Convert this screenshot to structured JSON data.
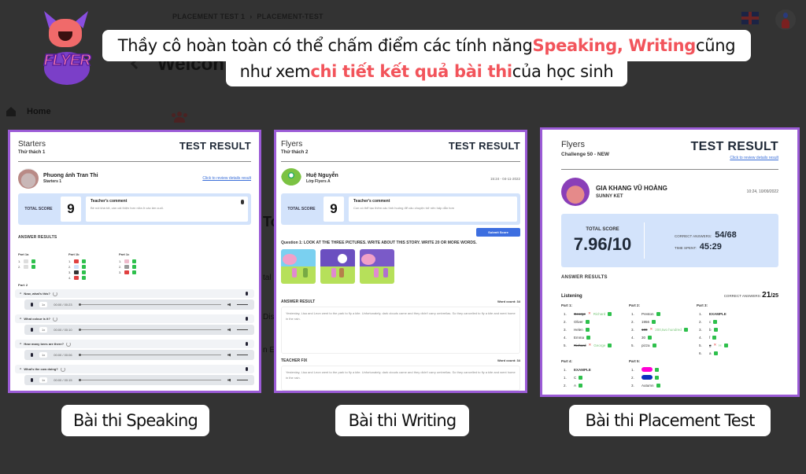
{
  "background_app": {
    "breadcrumb": [
      "PLACEMENT TEST 1",
      "›",
      "PLACEMENT-TEST"
    ],
    "welcome_partial": "Welcon",
    "sidebar_home": "Home",
    "side_fragments": [
      "Tc",
      "tal",
      "Dis",
      "n E"
    ]
  },
  "logo": {
    "text": "FLYER"
  },
  "callout": {
    "line1_a": "Thầy cô hoàn toàn có thể chấm điểm các tính năng ",
    "line1_hl": "Speaking, Writing",
    "line1_b": " cũng",
    "line2_a": "như xem ",
    "line2_hl": "chi tiết kết quả bài thi",
    "line2_b": " của học sinh",
    "highlight_color": "#f2545b"
  },
  "speaking_card": {
    "level": "Starters",
    "challenge": "Thử thách 1",
    "title": "TEST RESULT",
    "student_name": "Phuong ánh Tran Thi",
    "student_class": "Starters 1",
    "review_link": "Click to review details result",
    "score_label": "TOTAL SCORE",
    "score": "9",
    "comment_title": "Teacher's comment",
    "comment_body": "Bé nói khá tốt, cần cải thiện hơn nữa ở các âm cuối.",
    "answer_results": "ANSWER RESULTS",
    "parts": [
      {
        "name": "Part 1a",
        "rows": [
          "1.",
          "2."
        ]
      },
      {
        "name": "Part 1b",
        "rows": [
          "1.",
          "2.",
          "3.",
          "4."
        ]
      },
      {
        "name": "Part 1c",
        "rows": [
          "1.",
          "2.",
          "3."
        ]
      }
    ],
    "part2": "Part 2",
    "questions": [
      {
        "q": "Now, what's this?",
        "speed": "1x",
        "time": "00:00 / 00:23"
      },
      {
        "q": "What colour is it?",
        "speed": "1x",
        "time": "00:00 / 00:10"
      },
      {
        "q": "How many bees are there?",
        "speed": "1x",
        "time": "00:00 / 00:06"
      },
      {
        "q": "What's the cow doing?",
        "speed": "1x",
        "time": "00:00 / 00:15"
      }
    ]
  },
  "writing_card": {
    "level": "Flyers",
    "challenge": "Thử thách 2",
    "title": "TEST RESULT",
    "student_name": "Huệ Nguyễn",
    "student_class": "Lớp Flyers A",
    "datetime": "15:24 - 04-11-2022",
    "score_label": "TOTAL SCORE",
    "score": "9",
    "comment_title": "Teacher's comment",
    "comment_body": "Con có thể tạo thêm các tình huống để câu chuyện trở nên hấp dẫn hơn",
    "submit_label": "Submit Score",
    "question": "Question 1: LOOK AT THE THREE PICTURES. WRITE ABOUT THIS STORY. WRITE 20 OR MORE WORDS.",
    "answer_label": "ANSWER RESULT",
    "answer_wordcount": "Word count: 34",
    "answer_text": "Yesterday, Lisa and Leon went to the park to fly a kite. Unfortunately, dark clouds came and they didn't carry umbrellas. So they cancelled to fly a kite and went home in the rain.",
    "fix_label": "TEACHER FIX",
    "fix_wordcount": "Word count: 34",
    "fix_text": "Yesterday, Lisa and Leon went to the park to fly a kite. Unfortunately, dark clouds came and they didn't carry umbrellas. So they cancelled to fly a kite and went home in the rain."
  },
  "placement_card": {
    "level": "Flyers",
    "challenge": "Challenge 50 - NEW",
    "title": "TEST RESULT",
    "review_link": "Click to review details result",
    "student_name": "GIA KHANG VŨ HOÀNG",
    "student_class": "SUNNY KET",
    "datetime": "10:24, 10/09/2022",
    "score_label": "TOTAL SCORE",
    "score": "7.96/10",
    "correct_label": "CORRECT ANSWERS:",
    "correct_value": "54/68",
    "time_label": "TIME SPENT:",
    "time_value": "45:29",
    "answer_results": "ANSWER RESULTS",
    "section": "Listening",
    "section_correct_label": "CORRECT ANSWERS:",
    "section_correct": "21",
    "section_total": "/25",
    "parts": [
      {
        "name": "Part 1:",
        "rows": [
          {
            "n": "1.",
            "ans": "George",
            "wrong": true,
            "fix": "Richard"
          },
          {
            "n": "2.",
            "ans": "Oliver"
          },
          {
            "n": "3.",
            "ans": "Helen"
          },
          {
            "n": "4.",
            "ans": "Emma"
          },
          {
            "n": "5.",
            "ans": "Richard",
            "wrong": true,
            "fix": "George"
          }
        ]
      },
      {
        "name": "Part 2:",
        "rows": [
          {
            "n": "1.",
            "ans": "Preston"
          },
          {
            "n": "2.",
            "ans": "1956"
          },
          {
            "n": "3.",
            "ans": "100",
            "wrong": true,
            "fix": "200,two hundred"
          },
          {
            "n": "4.",
            "ans": "30"
          },
          {
            "n": "5.",
            "ans": "pizza"
          }
        ]
      },
      {
        "name": "Part 3:",
        "rows": [
          {
            "n": "1.",
            "ans": "EXAMPLE",
            "example": true
          },
          {
            "n": "2.",
            "ans": "c"
          },
          {
            "n": "3.",
            "ans": "b"
          },
          {
            "n": "4.",
            "ans": "f"
          },
          {
            "n": "5.",
            "ans": "g",
            "wrong": true,
            "fix": "H"
          },
          {
            "n": "6.",
            "ans": "a"
          }
        ]
      },
      {
        "name": "Part 4:",
        "rows": [
          {
            "n": "1.",
            "ans": "EXAMPLE",
            "example": true
          },
          {
            "n": "1.",
            "ans": "C"
          },
          {
            "n": "2.",
            "ans": "A"
          }
        ]
      },
      {
        "name": "Part 5:",
        "rows": [
          {
            "n": "1.",
            "color": "#ff00d4"
          },
          {
            "n": "2.",
            "color": "#0a2fbf"
          },
          {
            "n": "3.",
            "ans": "Autumn"
          }
        ]
      }
    ]
  },
  "labels": {
    "speaking": "Bài thi Speaking",
    "writing": "Bài thi Writing",
    "placement": "Bài thi Placement Test"
  }
}
